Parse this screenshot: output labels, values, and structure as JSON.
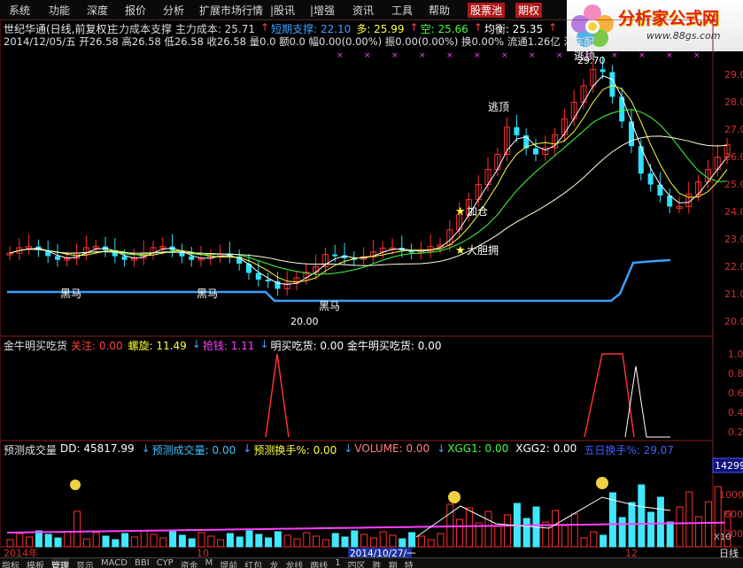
{
  "menubar": {
    "items": [
      "系统",
      "功能",
      "深度",
      "报价",
      "分析",
      "扩展市场行情",
      "|股讯",
      "|增强",
      "资讯",
      "工具",
      "帮助"
    ],
    "highlight_items": [
      "股票池",
      "期权"
    ]
  },
  "logo": {
    "title": "分析家公式网",
    "url": "www.88gs.com"
  },
  "header": {
    "stock_title": "世纪华通(日线,前复权)",
    "line1_parts": [
      {
        "text": "主力成本支撑  主力成本: 25.71",
        "color": "#d8d8d8"
      },
      {
        "text": "↑",
        "color": "#ff4040"
      },
      {
        "text": "短期支撑: 22.10",
        "color": "#40a0ff"
      },
      {
        "text": "多: 25.99",
        "color": "#ffff40"
      },
      {
        "text": "↑",
        "color": "#ff4040"
      },
      {
        "text": "空: 25.66",
        "color": "#40ff40"
      },
      {
        "text": "↑",
        "color": "#ff4040"
      },
      {
        "text": "均衡: 25.35",
        "color": "#ffffff"
      },
      {
        "text": "↑",
        "color": "#ff4040"
      }
    ],
    "line2": "2014/12/05/五 开26.58 高26.58 低26.58 收26.58 量0.0 额0.0 幅0.00(0.00%) 振0.00(0.00%) 换0.00% 流通1.26亿 汽车配"
  },
  "price_panel": {
    "y_labels": [
      "29.0",
      "28.0",
      "27.0",
      "26.0",
      "25.0",
      "24.0",
      "23.0",
      "22.0",
      "21.0",
      "20.0"
    ],
    "annotations": {
      "heima1": "黑马",
      "heima2": "黑马",
      "heima3": "黑马",
      "low_price": "20.00",
      "high_price": "29.70",
      "jiacang": "加仓",
      "dadan": "大胆拥",
      "taoding": "逃顶",
      "taoding2": "逃顶"
    }
  },
  "indicator_panel": {
    "title": "金牛明买吃货",
    "parts": [
      {
        "text": "关注: 0.00",
        "color": "#ff4040"
      },
      {
        "text": "螺旋: 11.49",
        "color": "#ffff40"
      },
      {
        "text": "↓",
        "color": "#40a0ff"
      },
      {
        "text": "抢钱: 1.11",
        "color": "#ff40ff"
      },
      {
        "text": "↓",
        "color": "#40a0ff"
      },
      {
        "text": "明买吃货: 0.00  金牛明买吃货: 0.00",
        "color": "#ffffff"
      }
    ],
    "y_labels": [
      "1.0",
      "0.8",
      "0.6",
      "0.4",
      "0.2"
    ]
  },
  "volume_panel": {
    "title": "预测成交量",
    "parts": [
      {
        "text": "DD: 45817.99",
        "color": "#ffffff"
      },
      {
        "text": "↓",
        "color": "#40a0ff"
      },
      {
        "text": "预测成交量: 0.00",
        "color": "#40c0ff"
      },
      {
        "text": "↓",
        "color": "#40a0ff"
      },
      {
        "text": "预测换手%: 0.00",
        "color": "#ffff40"
      },
      {
        "text": "↓",
        "color": "#40a0ff"
      },
      {
        "text": "VOLUME: 0.00",
        "color": "#ff8080"
      },
      {
        "text": "↓",
        "color": "#40a0ff"
      },
      {
        "text": "XGG1: 0.00",
        "color": "#40ff40"
      },
      {
        "text": "XGG2: 0.00",
        "color": "#ffffff"
      },
      {
        "text": "五日换手%: 29.07",
        "color": "#4060ff"
      }
    ],
    "y_labels": [
      "1000",
      "600",
      "200"
    ],
    "value_box": "14299",
    "unit_box": "X10"
  },
  "date_axis": {
    "year": "2014年",
    "month10": "10",
    "cursor_date": "2014/10/27/一",
    "month12": "12",
    "period": "日线"
  },
  "bottom_tabs": [
    "指标",
    "模板",
    "管理",
    "显示",
    "MACD",
    "BBI",
    "CYP",
    "资金",
    "M",
    "提前",
    "红包",
    "龙",
    "龙线",
    "两线",
    "1",
    "四区",
    "胜",
    "期",
    "特"
  ]
}
